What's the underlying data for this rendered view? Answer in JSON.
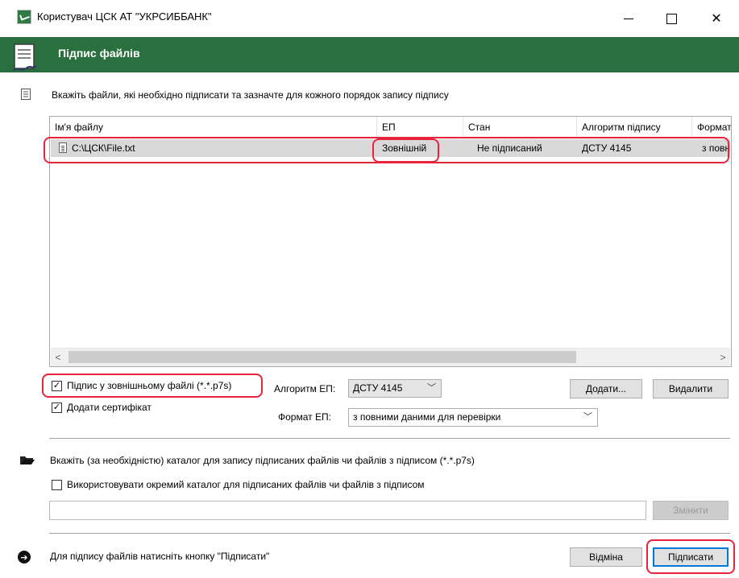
{
  "window": {
    "title": "Користувач ЦСК АТ \"УКРСИББАНК\""
  },
  "header": {
    "title": "Підпис файлів"
  },
  "files_section": {
    "hint": "Вкажіть файли, які необхідно підписати та зазначте для кожного порядок запису підпису",
    "columns": [
      "Ім'я файлу",
      "ЕП",
      "Стан",
      "Алгоритм підпису",
      "Формат ЕП"
    ],
    "rows": [
      {
        "file": "C:\\ЦСК\\File.txt",
        "ep": "Зовнішній",
        "status": "Не підписаний",
        "algorithm": "ДСТУ 4145",
        "format": "з повними даними для перевірки"
      }
    ],
    "scroll_left": "<",
    "scroll_right": ">"
  },
  "options": {
    "external_signature": {
      "label": "Підпис у зовнішньому файлі (*.*.p7s)",
      "checked": true,
      "mark": "✓"
    },
    "add_certificate": {
      "label": "Додати сертифікат",
      "checked": true,
      "mark": "✓"
    },
    "algorithm_label": "Алгоритм ЕП:",
    "algorithm_value": "ДСТУ 4145",
    "format_label": "Формат ЕП:",
    "format_value": "з повними даними для перевірки",
    "add_button": "Додати...",
    "remove_button": "Видалити"
  },
  "output_section": {
    "hint": "Вкажіть (за необхідністю) каталог для запису підписаних файлів чи файлів з підписом (*.*.p7s)",
    "separate_dir": {
      "label": "Використовувати окремий каталог для підписаних файлів чи файлів з підписом",
      "checked": false
    },
    "path_value": "",
    "change_button": "Змінити"
  },
  "footer": {
    "hint": "Для підпису файлів натисніть кнопку \"Підписати\"",
    "cancel_button": "Відміна",
    "sign_button": "Підписати"
  },
  "colors": {
    "header_green": "#2a6f3e",
    "highlight_red": "#e8233c",
    "selection_gray": "#d9d9d9",
    "default_button_blue": "#0078d7"
  }
}
